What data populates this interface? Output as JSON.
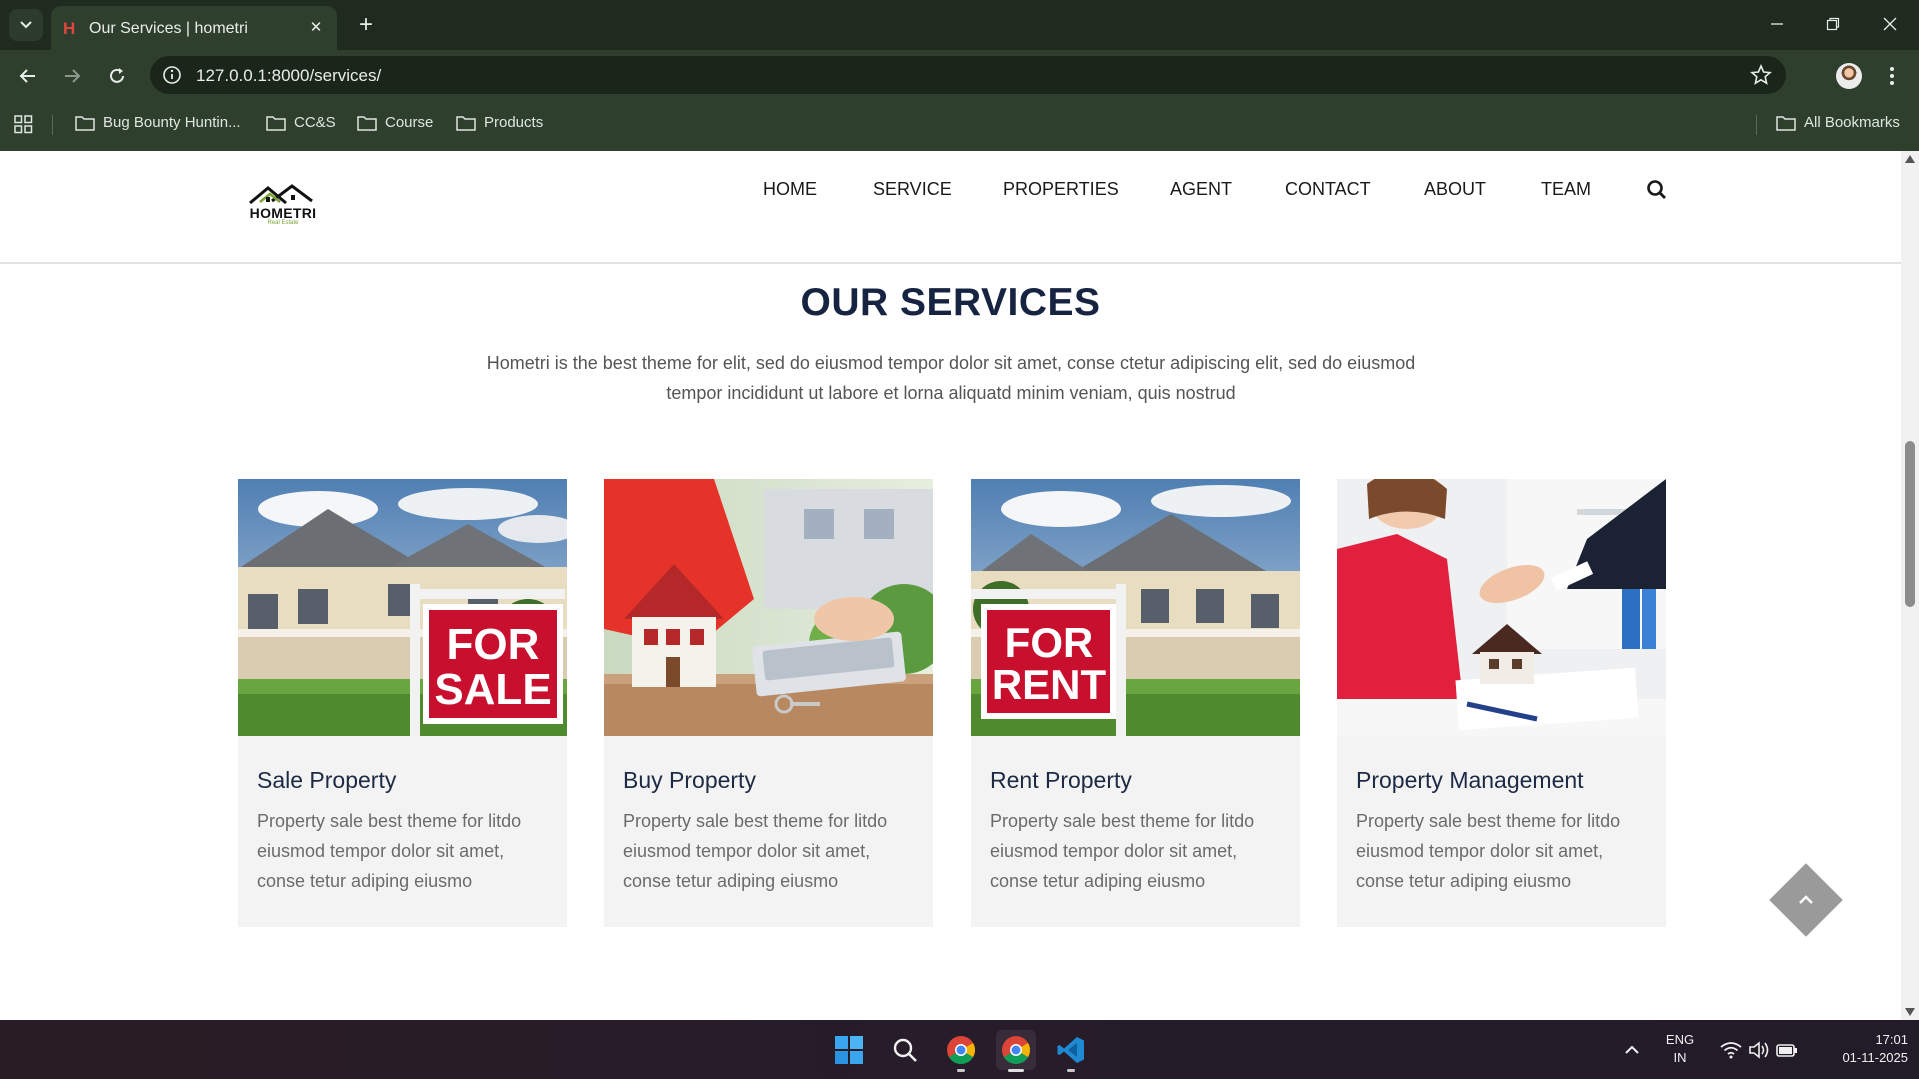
{
  "browser": {
    "tab_title": "Our Services | hometri",
    "url": "127.0.0.1:8000/services/",
    "bookmarks": [
      "Bug Bounty Huntin...",
      "CC&S",
      "Course",
      "Products"
    ],
    "all_bookmarks": "All Bookmarks"
  },
  "site": {
    "logo_text": "HOMETRI",
    "logo_sub": "Real Estate",
    "nav": [
      "HOME",
      "SERVICE",
      "PROPERTIES",
      "AGENT",
      "CONTACT",
      "ABOUT",
      "TEAM"
    ],
    "section_title": "OUR SERVICES",
    "section_desc": "Hometri is the best theme for elit, sed do eiusmod tempor dolor sit amet, conse ctetur adipiscing elit, sed do eiusmod tempor incididunt ut labore et lorna aliquatd minim veniam, quis nostrud",
    "cards": [
      {
        "title": "Sale Property",
        "text": "Property sale best theme for litdo eiusmod tempor dolor sit amet, conse tetur adiping eiusmo",
        "image": "for-sale-house"
      },
      {
        "title": "Buy Property",
        "text": "Property sale best theme for litdo eiusmod tempor dolor sit amet, conse tetur adiping eiusmo",
        "image": "house-model-calculator"
      },
      {
        "title": "Rent Property",
        "text": "Property sale best theme for litdo eiusmod tempor dolor sit amet, conse tetur adiping eiusmo",
        "image": "for-rent-house"
      },
      {
        "title": "Property Management",
        "text": "Property sale best theme for litdo eiusmod tempor dolor sit amet, conse tetur adiping eiusmo",
        "image": "handshake-deal"
      }
    ],
    "sign_sale": [
      "FOR",
      "SALE"
    ],
    "sign_rent": [
      "FOR",
      "RENT"
    ]
  },
  "taskbar": {
    "lang": "ENG",
    "region": "IN",
    "time": "17:01",
    "date": "01-11-2025"
  },
  "colors": {
    "browser_dark": "#1e2b1e",
    "browser_toolbar": "#2e3f2e",
    "title_navy": "#162341",
    "card_bg": "#f3f3f3"
  }
}
